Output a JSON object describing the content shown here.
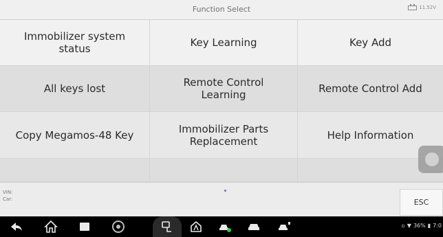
{
  "header": {
    "title": "Function Select",
    "voltage": "11.52V"
  },
  "functions": [
    "Immobilizer system status",
    "Key Learning",
    "Key Add",
    "All keys lost",
    "Remote Control Learning",
    "Remote Control Add",
    "Copy Megamos-48 Key",
    "Immobilizer Parts Replacement",
    "Help Information",
    "",
    "",
    ""
  ],
  "info": {
    "vin_label": "VIN:",
    "car_label": "Car:",
    "esc_label": "ESC"
  },
  "navbar": {
    "icons": [
      "back-icon",
      "home-icon",
      "recent-apps-icon",
      "chrome-icon",
      "vci-icon",
      "autel-home-icon",
      "car-service-icon",
      "car-icon",
      "car-settings-icon"
    ],
    "status_text": "36%",
    "time": "7:0"
  }
}
